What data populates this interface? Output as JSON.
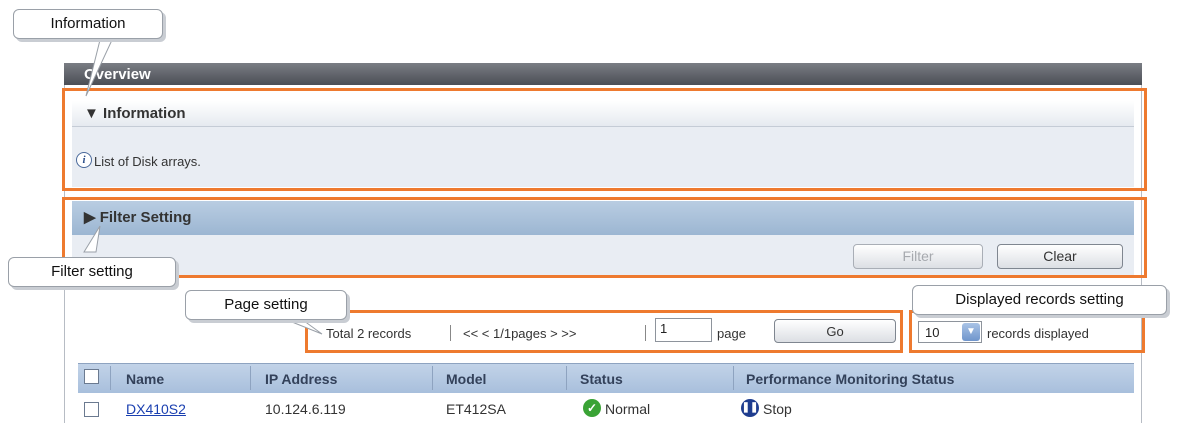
{
  "overview_title": "Overview",
  "information": {
    "header": "Information",
    "expanded_icon": "triangle-down",
    "icon": "info-circle-icon",
    "text": "List of Disk arrays."
  },
  "filter": {
    "header": "Filter Setting",
    "collapsed_icon": "triangle-right",
    "filter_button": "Filter",
    "clear_button": "Clear"
  },
  "paging": {
    "total_records": "Total 2 records",
    "nav": "<< < 1/1pages > >>",
    "page_value": "1",
    "page_label": "page",
    "go_button": "Go",
    "records_per_page": "10",
    "records_label": "records displayed"
  },
  "table": {
    "columns": [
      "Name",
      "IP Address",
      "Model",
      "Status",
      "Performance Monitoring Status"
    ],
    "rows": [
      {
        "name": "DX410S2",
        "ip": "10.124.6.119",
        "model": "ET412SA",
        "status": "Normal",
        "perf_status": "Stop"
      }
    ]
  },
  "callouts": {
    "information": "Information",
    "filter_setting": "Filter setting",
    "page_setting": "Page setting",
    "displayed_records": "Displayed records setting"
  },
  "colors": {
    "highlight": "#ee7a2f",
    "title_bar": "#4b4e55",
    "filter_header": "#9cb6d2",
    "status_ok": "#3aa335",
    "status_stop": "#1f3d8f"
  }
}
